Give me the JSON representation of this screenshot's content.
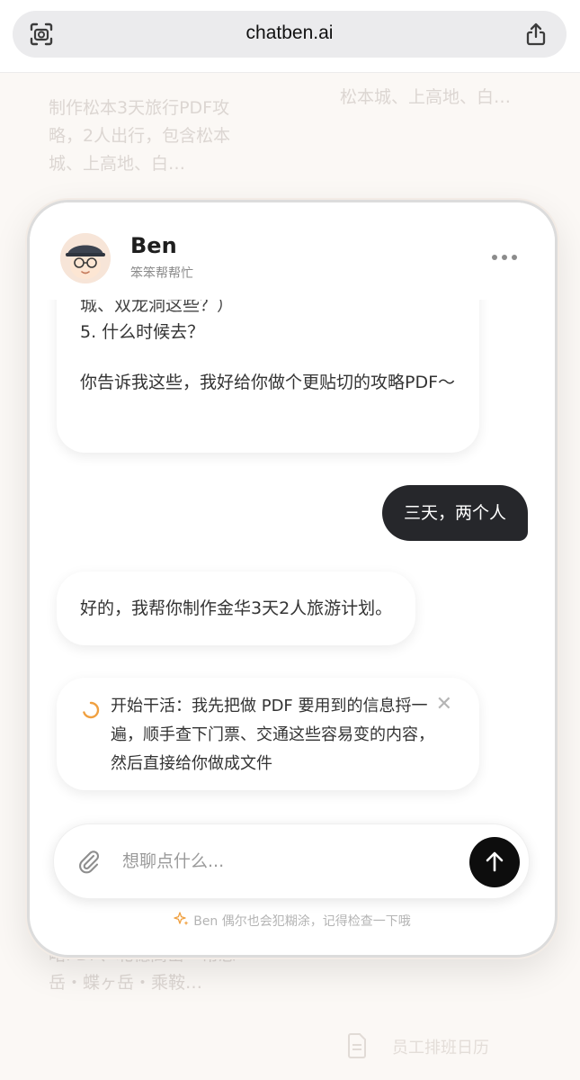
{
  "browser": {
    "url": "chatben.ai"
  },
  "background": {
    "left_text": "制作松本3天旅行PDF攻略，2人出行，包含松本城、上高地、白…",
    "right_text": "松本城、上高地、白…",
    "bottom_text": "略PDF、北穗高岳・常念岳・蝶ヶ岳・乘鞍…",
    "doc_label": "员工排班日历"
  },
  "chat": {
    "bot_name": "Ben",
    "bot_subtitle": "笨笨帮帮忙",
    "messages": {
      "bot_1_clipped": "城、双龙洞这些？）",
      "bot_1_line_5": "5. 什么时候去？",
      "bot_1_closing": "你告诉我这些，我好给你做个更贴切的攻略PDF～",
      "user_1": "三天，两个人",
      "bot_2": "好的，我帮你制作金华3天2人旅游计划。",
      "status": "开始干活：我先把做 PDF 要用到的信息捋一遍，顺手查下门票、交通这些容易变的内容，然后直接给你做成文件"
    },
    "input": {
      "placeholder": "想聊点什么..."
    },
    "disclaimer": "Ben 偶尔也会犯糊涂，记得检查一下哦"
  },
  "icons": {
    "screenshot": "camera-scan-icon",
    "share": "share-icon",
    "more": "more-dots-icon",
    "attach": "paperclip-icon",
    "send": "arrow-up-icon",
    "spinner": "loading-spinner-icon",
    "close": "close-icon",
    "sparkle": "sparkle-icon",
    "document": "document-icon"
  },
  "colors": {
    "accent_orange": "#f0a040",
    "user_bubble": "#26272b",
    "send_button": "#0d0d0d"
  }
}
